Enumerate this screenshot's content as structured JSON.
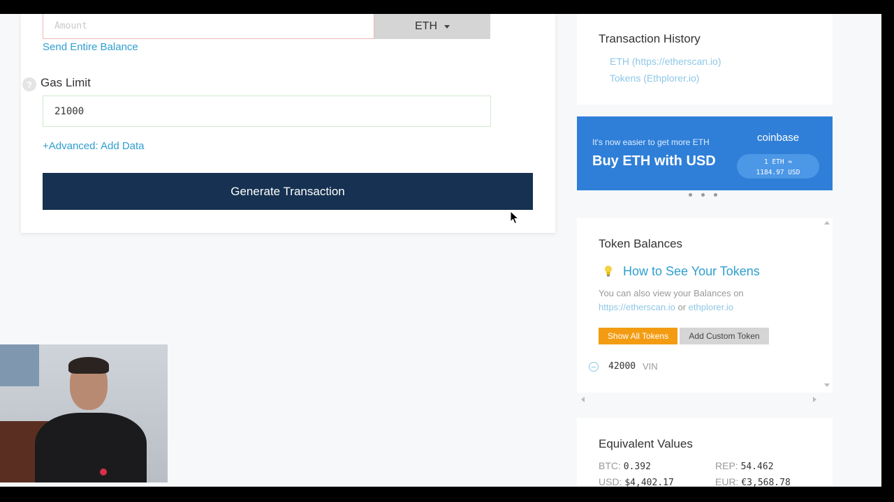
{
  "send_form": {
    "amount_placeholder": "Amount",
    "currency": "ETH",
    "send_entire_balance": "Send Entire Balance",
    "gas_limit_label": "Gas Limit",
    "help_glyph": "?",
    "gas_limit_value": "21000",
    "advanced_link": "+Advanced: Add Data",
    "generate_button": "Generate Transaction"
  },
  "history": {
    "title": "Transaction History",
    "links": [
      "ETH (https://etherscan.io)",
      "Tokens (Ethplorer.io)"
    ]
  },
  "banner": {
    "tagline": "It's now easier to get more ETH",
    "headline": "Buy ETH with USD",
    "brand": "coinbase",
    "rate_line1": "1 ETH ≈",
    "rate_line2": "1184.97 USD",
    "color": "#2f7fd8"
  },
  "tokens": {
    "title": "Token Balances",
    "how_to_title": "How to See Your Tokens",
    "also_view_text": "You can also view your Balances on",
    "link_etherscan": "https://etherscan.io",
    "or_text": "or",
    "link_ethplorer": "ethplorer.io",
    "show_all_button": "Show All Tokens",
    "add_custom_button": "Add Custom Token",
    "rows": [
      {
        "amount": "42000",
        "symbol": "VIN"
      }
    ]
  },
  "equivalent": {
    "title": "Equivalent Values",
    "btc_label": "BTC:",
    "btc_value": "0.392",
    "rep_label": "REP:",
    "rep_value": "54.462",
    "usd_label": "USD:",
    "usd_value": "$4,402.17",
    "eur_label": "EUR:",
    "eur_value": "€3,568.78"
  },
  "colors": {
    "accent_link": "#2f9ecf",
    "primary_button": "#163151",
    "warning_button": "#f39c12"
  }
}
